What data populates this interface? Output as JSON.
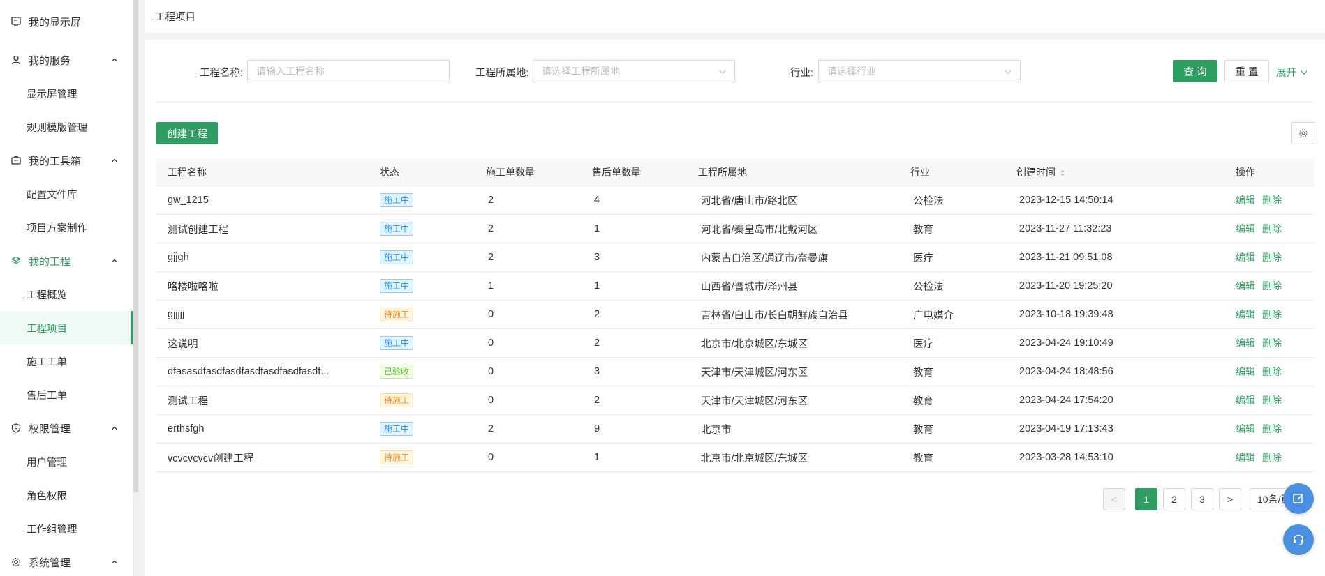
{
  "sidebar": {
    "groups": [
      {
        "label": "我的显示屏",
        "icon": "display-icon",
        "items": []
      },
      {
        "label": "我的服务",
        "icon": "user-icon",
        "items": [
          "显示屏管理",
          "规则模版管理"
        ]
      },
      {
        "label": "我的工具箱",
        "icon": "toolbox-icon",
        "items": [
          "配置文件库",
          "项目方案制作"
        ]
      },
      {
        "label": "我的工程",
        "icon": "layers-icon",
        "items": [
          "工程概览",
          "工程项目",
          "施工工单",
          "售后工单"
        ]
      },
      {
        "label": "权限管理",
        "icon": "shield-icon",
        "items": [
          "用户管理",
          "角色权限",
          "工作组管理"
        ]
      },
      {
        "label": "系统管理",
        "icon": "gear-icon",
        "items": []
      }
    ]
  },
  "breadcrumb": "工程项目",
  "filters": {
    "name_label": "工程名称:",
    "name_placeholder": "请输入工程名称",
    "location_label": "工程所属地:",
    "location_placeholder": "请选择工程所属地",
    "industry_label": "行业:",
    "industry_placeholder": "请选择行业",
    "query_label": "查 询",
    "reset_label": "重 置",
    "expand_label": "展开"
  },
  "create_label": "创建工程",
  "table": {
    "headers": [
      "工程名称",
      "状态",
      "施工单数量",
      "售后单数量",
      "工程所属地",
      "行业",
      "创建时间",
      "操作"
    ],
    "rows": [
      {
        "name": "gw_1215",
        "status": "施工中",
        "status_color": "blue",
        "work_orders": "2",
        "after_sales": "4",
        "location": "河北省/唐山市/路北区",
        "industry": "公检法",
        "created": "2023-12-15 14:50:14"
      },
      {
        "name": "测试创建工程",
        "status": "施工中",
        "status_color": "blue",
        "work_orders": "2",
        "after_sales": "1",
        "location": "河北省/秦皇岛市/北戴河区",
        "industry": "教育",
        "created": "2023-11-27 11:32:23"
      },
      {
        "name": "gjjgh",
        "status": "施工中",
        "status_color": "blue",
        "work_orders": "2",
        "after_sales": "3",
        "location": "内蒙古自治区/通辽市/奈曼旗",
        "industry": "医疗",
        "created": "2023-11-21 09:51:08"
      },
      {
        "name": "咯楼啦咯啦",
        "status": "施工中",
        "status_color": "blue",
        "work_orders": "1",
        "after_sales": "1",
        "location": "山西省/晋城市/泽州县",
        "industry": "公检法",
        "created": "2023-11-20 19:25:20"
      },
      {
        "name": "gjjjjj",
        "status": "待施工",
        "status_color": "orange",
        "work_orders": "0",
        "after_sales": "2",
        "location": "吉林省/白山市/长白朝鲜族自治县",
        "industry": "广电媒介",
        "created": "2023-10-18 19:39:48"
      },
      {
        "name": "这说明",
        "status": "施工中",
        "status_color": "blue",
        "work_orders": "0",
        "after_sales": "2",
        "location": "北京市/北京城区/东城区",
        "industry": "医疗",
        "created": "2023-04-24 19:10:49"
      },
      {
        "name": "dfasasdfasdfasdfasdfasdfasdfasdf...",
        "status": "已验收",
        "status_color": "green",
        "work_orders": "0",
        "after_sales": "3",
        "location": "天津市/天津城区/河东区",
        "industry": "教育",
        "created": "2023-04-24 18:48:56"
      },
      {
        "name": "测试工程",
        "status": "待施工",
        "status_color": "orange",
        "work_orders": "0",
        "after_sales": "2",
        "location": "天津市/天津城区/河东区",
        "industry": "教育",
        "created": "2023-04-24 17:54:20"
      },
      {
        "name": "erthsfgh",
        "status": "施工中",
        "status_color": "blue",
        "work_orders": "2",
        "after_sales": "9",
        "location": "北京市",
        "industry": "教育",
        "created": "2023-04-19 17:13:43"
      },
      {
        "name": "vcvcvcvcv创建工程",
        "status": "待施工",
        "status_color": "orange",
        "work_orders": "0",
        "after_sales": "1",
        "location": "北京市/北京城区/东城区",
        "industry": "教育",
        "created": "2023-03-28 14:53:10"
      }
    ],
    "edit_label": "编辑",
    "delete_label": "删除"
  },
  "pagination": {
    "prev": "<",
    "pages": [
      "1",
      "2",
      "3"
    ],
    "current": "1",
    "next": ">",
    "page_size": "10条/页"
  },
  "colors": {
    "primary": "#2e9d62",
    "tag_blue": "#1890ff",
    "tag_orange": "#fa8c16",
    "tag_green": "#52c41a",
    "float_button": "#4a90e2"
  }
}
